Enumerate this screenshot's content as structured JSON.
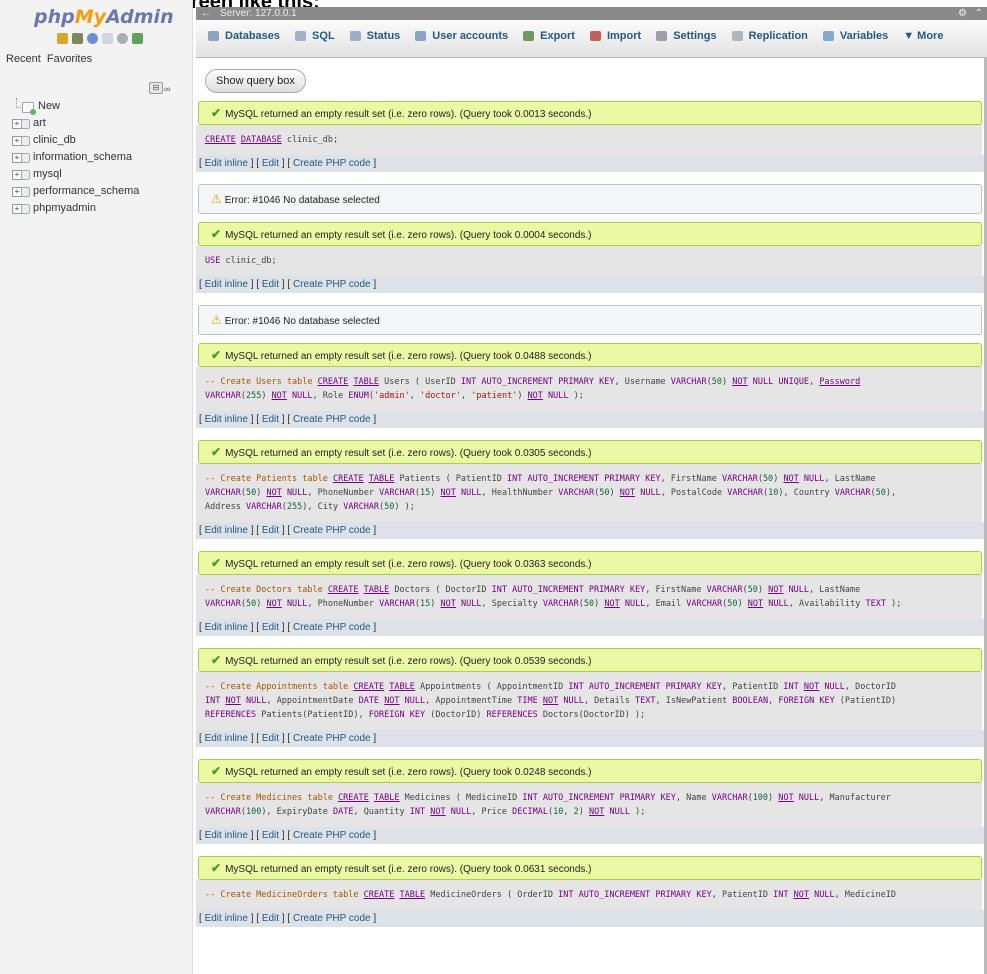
{
  "caption": "You should see a screen like this:",
  "sidebar": {
    "logo_php": "php",
    "logo_my": "My",
    "logo_admin": "Admin",
    "tabs": [
      "Recent",
      "Favorites"
    ],
    "collapse_glyph": "⊟",
    "link_glyph": "∞",
    "tree": [
      {
        "label": "New",
        "kind": "new"
      },
      {
        "label": "art",
        "kind": "db"
      },
      {
        "label": "clinic_db",
        "kind": "db"
      },
      {
        "label": "information_schema",
        "kind": "db"
      },
      {
        "label": "mysql",
        "kind": "db"
      },
      {
        "label": "performance_schema",
        "kind": "db"
      },
      {
        "label": "phpmyadmin",
        "kind": "db"
      }
    ],
    "expand_glyph": "+"
  },
  "topbar": {
    "server_label": "Server: 127.0.0.1",
    "gear_glyph": "⚙",
    "close_glyph": "⌃",
    "collapse_glyph": "←"
  },
  "menu": [
    {
      "label": "Databases",
      "icon": "databases-icon",
      "color": "#8fa3bd"
    },
    {
      "label": "SQL",
      "icon": "sql-icon",
      "color": "#9fb3c8"
    },
    {
      "label": "Status",
      "icon": "status-icon",
      "color": "#9bb0c8"
    },
    {
      "label": "User accounts",
      "icon": "users-icon",
      "color": "#8aa4c4"
    },
    {
      "label": "Export",
      "icon": "export-icon",
      "color": "#6f9a5d"
    },
    {
      "label": "Import",
      "icon": "import-icon",
      "color": "#c3605a"
    },
    {
      "label": "Settings",
      "icon": "settings-icon",
      "color": "#9aa0a8"
    },
    {
      "label": "Replication",
      "icon": "replication-icon",
      "color": "#b0b6be"
    },
    {
      "label": "Variables",
      "icon": "variables-icon",
      "color": "#7eaad0"
    },
    {
      "label": "▼ More",
      "icon": "more-icon",
      "color": ""
    }
  ],
  "show_query_label": "Show query box",
  "actions": {
    "edit_inline": "Edit inline",
    "edit": "Edit",
    "create_php": "Create PHP code"
  },
  "results": [
    {
      "type": "success",
      "message": "MySQL returned an empty result set (i.e. zero rows). (Query took 0.0013 seconds.)",
      "sql": "<span class='kw-u'>CREATE</span> <span class='kw-u'>DATABASE</span> clinic_db;"
    },
    {
      "type": "error",
      "message": "Error: #1046 No database selected"
    },
    {
      "type": "success",
      "message": "MySQL returned an empty result set (i.e. zero rows). (Query took 0.0004 seconds.)",
      "sql": "<span class='kw'>USE</span> clinic_db;"
    },
    {
      "type": "error",
      "message": "Error: #1046 No database selected"
    },
    {
      "type": "success",
      "message": "MySQL returned an empty result set (i.e. zero rows). (Query took 0.0488 seconds.)",
      "sql": "<span class='cm'>-- Create Users table</span> <span class='kw-u'>CREATE</span> <span class='kw-u'>TABLE</span> Users ( UserID <span class='kw'>INT</span> <span class='kw'>AUTO_INCREMENT</span> <span class='kw'>PRIMARY</span> <span class='kw'>KEY</span>, Username <span class='kw'>VARCHAR</span>(<span class='num'>50</span>) <span class='kw-u'>NOT</span> <span class='kw'>NULL</span> <span class='kw'>UNIQUE</span>, <span class='kw-u'>Password</span><br><span class='kw'>VARCHAR</span>(<span class='num'>255</span>) <span class='kw-u'>NOT</span> <span class='kw'>NULL</span>, Role <span class='kw'>ENUM</span>(<span class='str'>'admin'</span>, <span class='str'>'doctor'</span>, <span class='str'>'patient'</span>) <span class='kw-u'>NOT</span> <span class='kw'>NULL</span> );"
    },
    {
      "type": "success",
      "message": "MySQL returned an empty result set (i.e. zero rows). (Query took 0.0305 seconds.)",
      "sql": "<span class='cm'>-- Create Patients table</span> <span class='kw-u'>CREATE</span> <span class='kw-u'>TABLE</span> Patients ( PatientID <span class='kw'>INT</span> <span class='kw'>AUTO_INCREMENT</span> <span class='kw'>PRIMARY</span> <span class='kw'>KEY</span>, FirstName <span class='kw'>VARCHAR</span>(<span class='num'>50</span>) <span class='kw-u'>NOT</span> <span class='kw'>NULL</span>, LastName<br><span class='kw'>VARCHAR</span>(<span class='num'>50</span>) <span class='kw-u'>NOT</span> <span class='kw'>NULL</span>, PhoneNumber <span class='kw'>VARCHAR</span>(<span class='num'>15</span>) <span class='kw-u'>NOT</span> <span class='kw'>NULL</span>, HealthNumber <span class='kw'>VARCHAR</span>(<span class='num'>50</span>) <span class='kw-u'>NOT</span> <span class='kw'>NULL</span>, PostalCode <span class='kw'>VARCHAR</span>(<span class='num'>10</span>), Country <span class='kw'>VARCHAR</span>(<span class='num'>50</span>),<br>Address <span class='kw'>VARCHAR</span>(<span class='num'>255</span>), City <span class='kw'>VARCHAR</span>(<span class='num'>50</span>) );"
    },
    {
      "type": "success",
      "message": "MySQL returned an empty result set (i.e. zero rows). (Query took 0.0363 seconds.)",
      "sql": "<span class='cm'>-- Create Doctors table</span> <span class='kw-u'>CREATE</span> <span class='kw-u'>TABLE</span> Doctors ( DoctorID <span class='kw'>INT</span> <span class='kw'>AUTO_INCREMENT</span> <span class='kw'>PRIMARY</span> <span class='kw'>KEY</span>, FirstName <span class='kw'>VARCHAR</span>(<span class='num'>50</span>) <span class='kw-u'>NOT</span> <span class='kw'>NULL</span>, LastName<br><span class='kw'>VARCHAR</span>(<span class='num'>50</span>) <span class='kw-u'>NOT</span> <span class='kw'>NULL</span>, PhoneNumber <span class='kw'>VARCHAR</span>(<span class='num'>15</span>) <span class='kw-u'>NOT</span> <span class='kw'>NULL</span>, Specialty <span class='kw'>VARCHAR</span>(<span class='num'>50</span>) <span class='kw-u'>NOT</span> <span class='kw'>NULL</span>, Email <span class='kw'>VARCHAR</span>(<span class='num'>50</span>) <span class='kw-u'>NOT</span> <span class='kw'>NULL</span>, Availability <span class='kw'>TEXT</span> );"
    },
    {
      "type": "success",
      "message": "MySQL returned an empty result set (i.e. zero rows). (Query took 0.0539 seconds.)",
      "sql": "<span class='cm'>-- Create Appointments table</span> <span class='kw-u'>CREATE</span> <span class='kw-u'>TABLE</span> Appointments ( AppointmentID <span class='kw'>INT</span> <span class='kw'>AUTO_INCREMENT</span> <span class='kw'>PRIMARY</span> <span class='kw'>KEY</span>, PatientID <span class='kw'>INT</span> <span class='kw-u'>NOT</span> <span class='kw'>NULL</span>, DoctorID<br><span class='kw'>INT</span> <span class='kw-u'>NOT</span> <span class='kw'>NULL</span>, AppointmentDate <span class='kw'>DATE</span> <span class='kw-u'>NOT</span> <span class='kw'>NULL</span>, AppointmentTime <span class='kw'>TIME</span> <span class='kw-u'>NOT</span> <span class='kw'>NULL</span>, Details <span class='kw'>TEXT</span>, IsNewPatient <span class='kw'>BOOLEAN</span>, <span class='kw'>FOREIGN</span> <span class='kw'>KEY</span> (PatientID)<br><span class='kw'>REFERENCES</span> Patients(PatientID), <span class='kw'>FOREIGN</span> <span class='kw'>KEY</span> (DoctorID) <span class='kw'>REFERENCES</span> Doctors(DoctorID) );"
    },
    {
      "type": "success",
      "message": "MySQL returned an empty result set (i.e. zero rows). (Query took 0.0248 seconds.)",
      "sql": "<span class='cm'>-- Create Medicines table</span> <span class='kw-u'>CREATE</span> <span class='kw-u'>TABLE</span> Medicines ( MedicineID <span class='kw'>INT</span> <span class='kw'>AUTO_INCREMENT</span> <span class='kw'>PRIMARY</span> <span class='kw'>KEY</span>, Name <span class='kw'>VARCHAR</span>(<span class='num'>100</span>) <span class='kw-u'>NOT</span> <span class='kw'>NULL</span>, Manufacturer<br><span class='kw'>VARCHAR</span>(<span class='num'>100</span>), ExpiryDate <span class='kw'>DATE</span>, Quantity <span class='kw'>INT</span> <span class='kw-u'>NOT</span> <span class='kw'>NULL</span>, Price <span class='kw'>DECIMAL</span>(<span class='num'>10</span>, <span class='num'>2</span>) <span class='kw-u'>NOT</span> <span class='kw'>NULL</span> );"
    },
    {
      "type": "success",
      "message": "MySQL returned an empty result set (i.e. zero rows). (Query took 0.0631 seconds.)",
      "sql": "<span class='cm'>-- Create MedicineOrders table</span> <span class='kw-u'>CREATE</span> <span class='kw-u'>TABLE</span> MedicineOrders ( OrderID <span class='kw'>INT</span> <span class='kw'>AUTO_INCREMENT</span> <span class='kw'>PRIMARY</span> <span class='kw'>KEY</span>, PatientID <span class='kw'>INT</span> <span class='kw-u'>NOT</span> <span class='kw'>NULL</span>, MedicineID"
    }
  ]
}
